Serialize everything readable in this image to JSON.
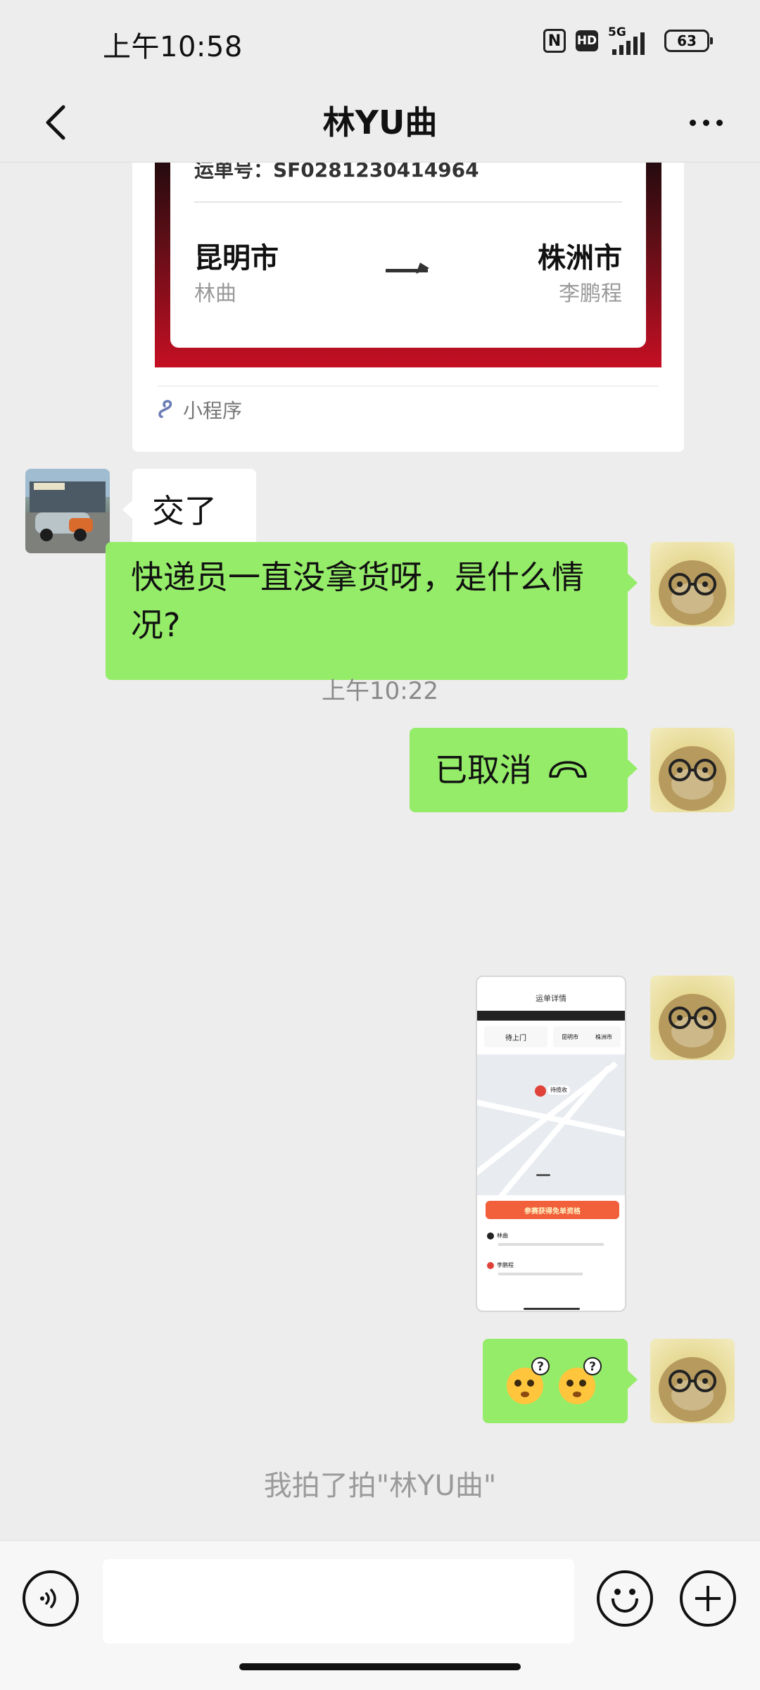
{
  "status_bar": {
    "time": "上午10:58",
    "nfc_label": "N",
    "hd_label": "HD",
    "network": "5G",
    "battery": "63"
  },
  "navbar": {
    "back_icon": "chevron-left-icon",
    "title": "林YU曲",
    "more_icon": "more-icon"
  },
  "shipment_card": {
    "waybill_label": "运单号：SF0281230414964",
    "from_city": "昆明市",
    "from_name": "林曲",
    "to_city": "株洲市",
    "to_name": "李鹏程",
    "source_label": "小程序",
    "source_icon": "mini-program-icon"
  },
  "messages": {
    "m1": "交了",
    "m2": "快递员一直没拿货呀，是什么情况?",
    "timestamp": "上午10:22",
    "m3_text": "已取消",
    "m3_icon": "phone-hangup-icon",
    "m4_screenshot": {
      "title": "运单详情",
      "status": "待上门",
      "from": "昆明市",
      "to": "株洲市",
      "pickup_marker": "待揽收",
      "banner": "参赛获得免单资格",
      "sender": "林曲",
      "receiver": "李鹏程"
    },
    "m5_emoji": "🫨🫨"
  },
  "system_notice": "我拍了拍\"林YU曲\"",
  "input_bar": {
    "voice_icon": "voice-icon",
    "text_value": "",
    "emoji_icon": "emoji-icon",
    "plus_icon": "plus-icon"
  },
  "colors": {
    "background": "#ededed",
    "bubble_green": "#95ec69",
    "bubble_white": "#ffffff",
    "card_red": "#c50f23"
  }
}
